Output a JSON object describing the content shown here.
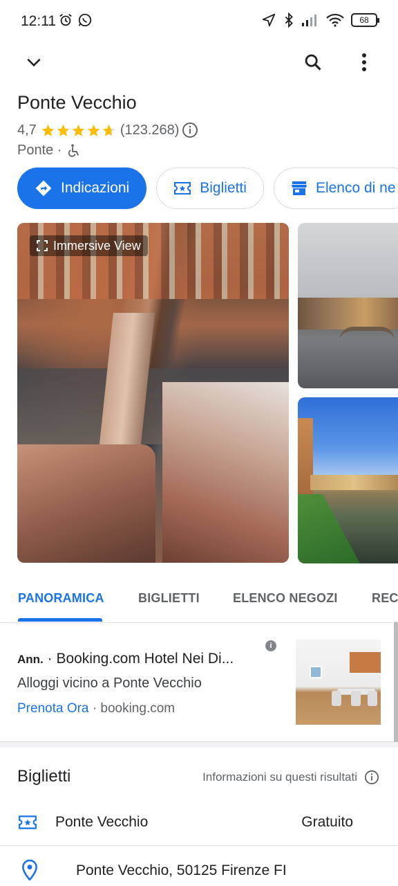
{
  "status_bar": {
    "time": "12:11",
    "battery": "68",
    "left_icons": [
      "alarm-icon",
      "whatsapp-icon"
    ],
    "right_icons": [
      "location-arrow-icon",
      "bluetooth-icon",
      "signal-icon",
      "wifi-icon",
      "battery-icon"
    ]
  },
  "place": {
    "title": "Ponte Vecchio",
    "rating": "4,7",
    "rating_value": 4.7,
    "review_count": "(123.268)",
    "type": "Ponte ·"
  },
  "chips": {
    "directions": "Indicazioni",
    "tickets": "Biglietti",
    "shops": "Elenco di ne"
  },
  "photos": {
    "immersive_label": "Immersive View"
  },
  "tabs": [
    "PANORAMICA",
    "BIGLIETTI",
    "ELENCO NEGOZI",
    "REC"
  ],
  "ad": {
    "prefix": "Ann.",
    "title": " · Booking.com Hotel Nei Di...",
    "description": "Alloggi vicino a Ponte Vecchio",
    "cta": "Prenota Ora",
    "domain": " · booking.com"
  },
  "tickets_section": {
    "heading": "Biglietti",
    "info": "Informazioni su questi risultati",
    "ticket_name": "Ponte Vecchio",
    "ticket_price": "Gratuito"
  },
  "address": "Ponte Vecchio, 50125 Firenze FI",
  "colors": {
    "accent": "#1a73e8",
    "star": "#fbbc04",
    "text_primary": "#202124",
    "text_secondary": "#5f6368"
  }
}
